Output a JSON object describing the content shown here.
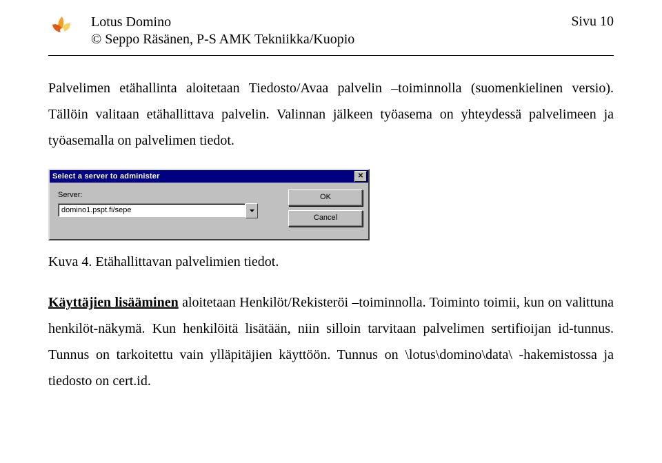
{
  "header": {
    "title_line1": "Lotus Domino",
    "title_line2": "© Seppo Räsänen, P-S AMK Tekniikka/Kuopio",
    "page_label": "Sivu 10"
  },
  "paragraph1": "Palvelimen etähallinta aloitetaan Tiedosto/Avaa palvelin –toiminnolla (suomenkielinen versio). Tällöin valitaan etähallittava palvelin. Valinnan jälkeen työasema on yhteydessä palvelimeen ja työasemalla on palvelimen tiedot.",
  "dialog": {
    "title": "Select a server to administer",
    "server_label": "Server:",
    "server_value": "domino1.pspt.fi/sepe",
    "ok_label": "OK",
    "cancel_label": "Cancel"
  },
  "figure_caption": "Kuva 4. Etähallittavan palvelimien tiedot.",
  "paragraph2_lead": "Käyttäjien lisääminen",
  "paragraph2_rest": " aloitetaan Henkilöt/Rekisteröi –toiminnolla. Toiminto toimii, kun on valittuna henkilöt-näkymä. Kun henkilöitä lisätään, niin silloin tarvitaan palvelimen sertifioijan id-tunnus. Tunnus on tarkoitettu vain ylläpitäjien käyttöön. Tunnus on \\lotus\\domino\\data\\ -hakemistossa ja tiedosto on cert.id."
}
